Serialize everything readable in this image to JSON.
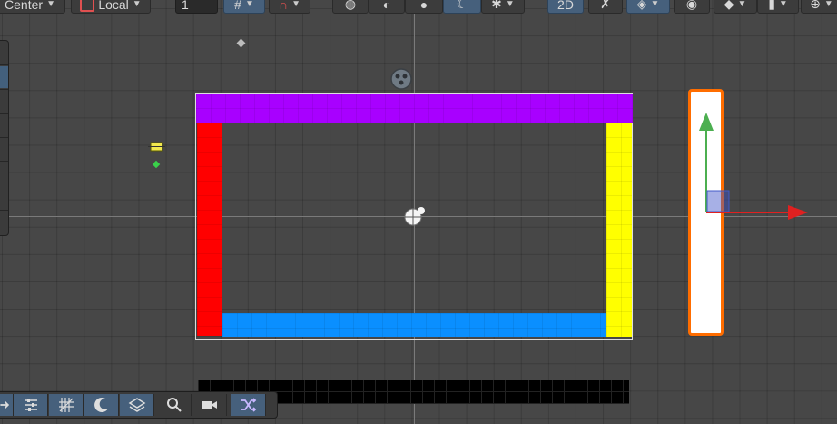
{
  "toolbar": {
    "pivot_mode": "Center",
    "pivot_rotation": "Local",
    "grid_increment_value": "1",
    "view_2d_label": "2D"
  },
  "colors": {
    "wall_top": "#a800ff",
    "wall_left": "#ff0000",
    "wall_right": "#ffff00",
    "wall_bottom": "#0a8fff",
    "selection_outline": "#ff6d00",
    "toolbar_active": "#46607c",
    "axis_y": "#4caf50",
    "axis_x": "#e02020"
  },
  "scene": {
    "objects": [
      {
        "name": "wall-top",
        "color": "#a800ff"
      },
      {
        "name": "wall-left",
        "color": "#ff0000"
      },
      {
        "name": "wall-right",
        "color": "#ffff00"
      },
      {
        "name": "wall-bottom",
        "color": "#0a8fff"
      },
      {
        "name": "selected-paddle",
        "color": "#ffffff"
      }
    ]
  },
  "overlay_tools": [
    {
      "icon": "arrow-right-icon",
      "active": true
    },
    {
      "icon": "sliders-icon",
      "active": true
    },
    {
      "icon": "grid-hatch-icon",
      "active": true
    },
    {
      "icon": "moon-icon",
      "active": true
    },
    {
      "icon": "layers-icon",
      "active": true
    },
    {
      "icon": "search-icon",
      "active": false
    },
    {
      "icon": "camera-icon",
      "active": false
    },
    {
      "icon": "shuffle-icon",
      "active": true
    }
  ]
}
